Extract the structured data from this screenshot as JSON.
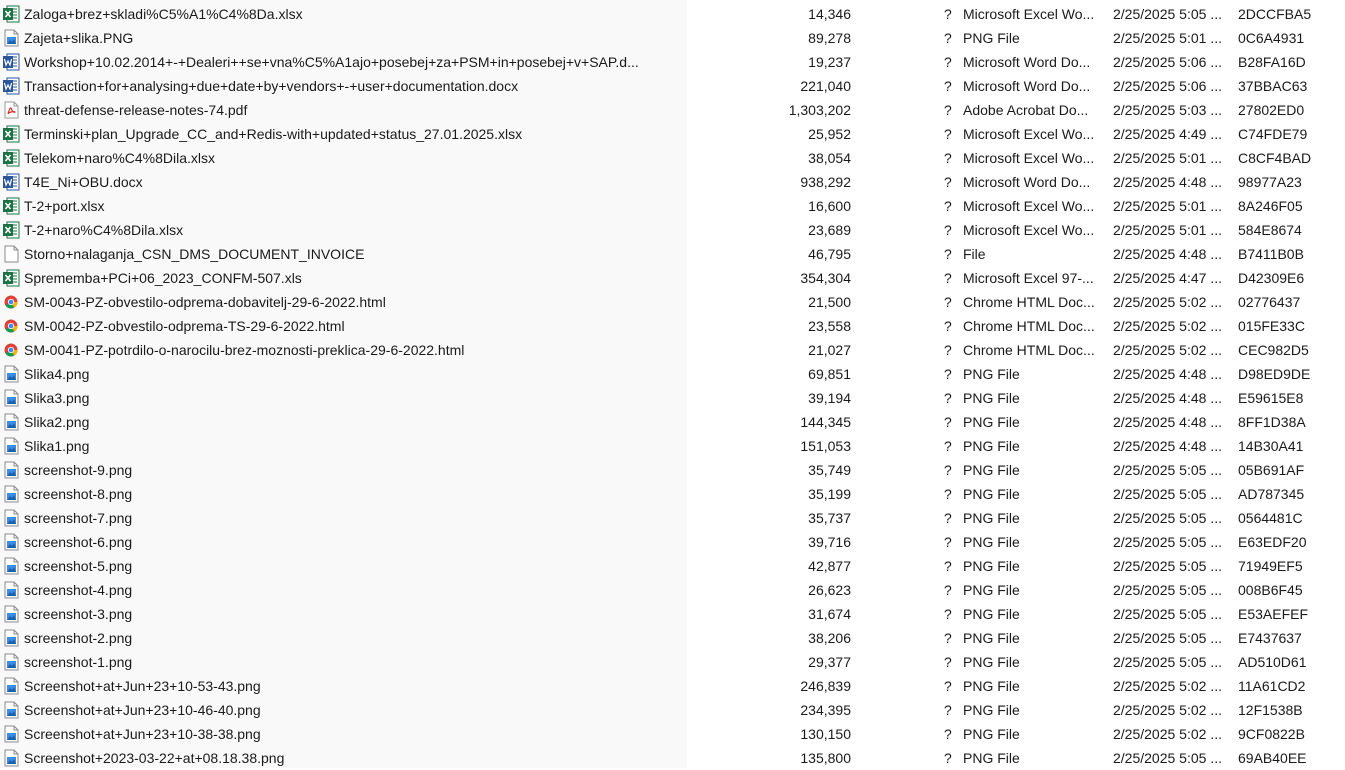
{
  "file_list": {
    "rows": [
      {
        "name": "Zaloga+brez+skladi%C5%A1%C4%8Da.xlsx",
        "size": "14,346",
        "flag": "?",
        "type": "Microsoft Excel Wo...",
        "date": "2/25/2025 5:05 ...",
        "crc": "2DCCFBA5",
        "icon": "excel-icon"
      },
      {
        "name": "Zajeta+slika.PNG",
        "size": "89,278",
        "flag": "?",
        "type": "PNG File",
        "date": "2/25/2025 5:01 ...",
        "crc": "0C6A4931",
        "icon": "image-icon"
      },
      {
        "name": "Workshop+10.02.2014+-+Dealeri++se+vna%C5%A1ajo+posebej+za+PSM+in+posebej+v+SAP.d...",
        "size": "19,237",
        "flag": "?",
        "type": "Microsoft Word Do...",
        "date": "2/25/2025 5:06 ...",
        "crc": "B28FA16D",
        "icon": "word-icon"
      },
      {
        "name": "Transaction+for+analysing+due+date+by+vendors+-+user+documentation.docx",
        "size": "221,040",
        "flag": "?",
        "type": "Microsoft Word Do...",
        "date": "2/25/2025 5:06 ...",
        "crc": "37BBAC63",
        "icon": "word-icon"
      },
      {
        "name": "threat-defense-release-notes-74.pdf",
        "size": "1,303,202",
        "flag": "?",
        "type": "Adobe Acrobat Do...",
        "date": "2/25/2025 5:03 ...",
        "crc": "27802ED0",
        "icon": "pdf-icon"
      },
      {
        "name": "Terminski+plan_Upgrade_CC_and+Redis-with+updated+status_27.01.2025.xlsx",
        "size": "25,952",
        "flag": "?",
        "type": "Microsoft Excel Wo...",
        "date": "2/25/2025 4:49 ...",
        "crc": "C74FDE79",
        "icon": "excel-icon"
      },
      {
        "name": "Telekom+naro%C4%8Dila.xlsx",
        "size": "38,054",
        "flag": "?",
        "type": "Microsoft Excel Wo...",
        "date": "2/25/2025 5:01 ...",
        "crc": "C8CF4BAD",
        "icon": "excel-icon"
      },
      {
        "name": "T4E_Ni+OBU.docx",
        "size": "938,292",
        "flag": "?",
        "type": "Microsoft Word Do...",
        "date": "2/25/2025 4:48 ...",
        "crc": "98977A23",
        "icon": "word-icon"
      },
      {
        "name": "T-2+port.xlsx",
        "size": "16,600",
        "flag": "?",
        "type": "Microsoft Excel Wo...",
        "date": "2/25/2025 5:01 ...",
        "crc": "8A246F05",
        "icon": "excel-icon"
      },
      {
        "name": "T-2+naro%C4%8Dila.xlsx",
        "size": "23,689",
        "flag": "?",
        "type": "Microsoft Excel Wo...",
        "date": "2/25/2025 5:01 ...",
        "crc": "584E8674",
        "icon": "excel-icon"
      },
      {
        "name": "Storno+nalaganja_CSN_DMS_DOCUMENT_INVOICE",
        "size": "46,795",
        "flag": "?",
        "type": "File",
        "date": "2/25/2025 4:48 ...",
        "crc": "B7411B0B",
        "icon": "file-icon"
      },
      {
        "name": "Sprememba+PCi+06_2023_CONFM-507.xls",
        "size": "354,304",
        "flag": "?",
        "type": "Microsoft Excel 97-...",
        "date": "2/25/2025 4:47 ...",
        "crc": "D42309E6",
        "icon": "excel-icon"
      },
      {
        "name": "SM-0043-PZ-obvestilo-odprema-dobavitelj-29-6-2022.html",
        "size": "21,500",
        "flag": "?",
        "type": "Chrome HTML Doc...",
        "date": "2/25/2025 5:02 ...",
        "crc": "02776437",
        "icon": "chrome-icon"
      },
      {
        "name": "SM-0042-PZ-obvestilo-odprema-TS-29-6-2022.html",
        "size": "23,558",
        "flag": "?",
        "type": "Chrome HTML Doc...",
        "date": "2/25/2025 5:02 ...",
        "crc": "015FE33C",
        "icon": "chrome-icon"
      },
      {
        "name": "SM-0041-PZ-potrdilo-o-narocilu-brez-moznosti-preklica-29-6-2022.html",
        "size": "21,027",
        "flag": "?",
        "type": "Chrome HTML Doc...",
        "date": "2/25/2025 5:02 ...",
        "crc": "CEC982D5",
        "icon": "chrome-icon"
      },
      {
        "name": "Slika4.png",
        "size": "69,851",
        "flag": "?",
        "type": "PNG File",
        "date": "2/25/2025 4:48 ...",
        "crc": "D98ED9DE",
        "icon": "image-icon"
      },
      {
        "name": "Slika3.png",
        "size": "39,194",
        "flag": "?",
        "type": "PNG File",
        "date": "2/25/2025 4:48 ...",
        "crc": "E59615E8",
        "icon": "image-icon"
      },
      {
        "name": "Slika2.png",
        "size": "144,345",
        "flag": "?",
        "type": "PNG File",
        "date": "2/25/2025 4:48 ...",
        "crc": "8FF1D38A",
        "icon": "image-icon"
      },
      {
        "name": "Slika1.png",
        "size": "151,053",
        "flag": "?",
        "type": "PNG File",
        "date": "2/25/2025 4:48 ...",
        "crc": "14B30A41",
        "icon": "image-icon"
      },
      {
        "name": "screenshot-9.png",
        "size": "35,749",
        "flag": "?",
        "type": "PNG File",
        "date": "2/25/2025 5:05 ...",
        "crc": "05B691AF",
        "icon": "image-icon"
      },
      {
        "name": "screenshot-8.png",
        "size": "35,199",
        "flag": "?",
        "type": "PNG File",
        "date": "2/25/2025 5:05 ...",
        "crc": "AD787345",
        "icon": "image-icon"
      },
      {
        "name": "screenshot-7.png",
        "size": "35,737",
        "flag": "?",
        "type": "PNG File",
        "date": "2/25/2025 5:05 ...",
        "crc": "0564481C",
        "icon": "image-icon"
      },
      {
        "name": "screenshot-6.png",
        "size": "39,716",
        "flag": "?",
        "type": "PNG File",
        "date": "2/25/2025 5:05 ...",
        "crc": "E63EDF20",
        "icon": "image-icon"
      },
      {
        "name": "screenshot-5.png",
        "size": "42,877",
        "flag": "?",
        "type": "PNG File",
        "date": "2/25/2025 5:05 ...",
        "crc": "71949EF5",
        "icon": "image-icon"
      },
      {
        "name": "screenshot-4.png",
        "size": "26,623",
        "flag": "?",
        "type": "PNG File",
        "date": "2/25/2025 5:05 ...",
        "crc": "008B6F45",
        "icon": "image-icon"
      },
      {
        "name": "screenshot-3.png",
        "size": "31,674",
        "flag": "?",
        "type": "PNG File",
        "date": "2/25/2025 5:05 ...",
        "crc": "E53AEFEF",
        "icon": "image-icon"
      },
      {
        "name": "screenshot-2.png",
        "size": "38,206",
        "flag": "?",
        "type": "PNG File",
        "date": "2/25/2025 5:05 ...",
        "crc": "E7437637",
        "icon": "image-icon"
      },
      {
        "name": "screenshot-1.png",
        "size": "29,377",
        "flag": "?",
        "type": "PNG File",
        "date": "2/25/2025 5:05 ...",
        "crc": "AD510D61",
        "icon": "image-icon"
      },
      {
        "name": "Screenshot+at+Jun+23+10-53-43.png",
        "size": "246,839",
        "flag": "?",
        "type": "PNG File",
        "date": "2/25/2025 5:02 ...",
        "crc": "11A61CD2",
        "icon": "image-icon"
      },
      {
        "name": "Screenshot+at+Jun+23+10-46-40.png",
        "size": "234,395",
        "flag": "?",
        "type": "PNG File",
        "date": "2/25/2025 5:02 ...",
        "crc": "12F1538B",
        "icon": "image-icon"
      },
      {
        "name": "Screenshot+at+Jun+23+10-38-38.png",
        "size": "130,150",
        "flag": "?",
        "type": "PNG File",
        "date": "2/25/2025 5:02 ...",
        "crc": "9CF0822B",
        "icon": "image-icon"
      },
      {
        "name": "Screenshot+2023-03-22+at+08.18.38.png",
        "size": "135,800",
        "flag": "?",
        "type": "PNG File",
        "date": "2/25/2025 5:05 ...",
        "crc": "69AB40EE",
        "icon": "image-icon"
      }
    ]
  }
}
